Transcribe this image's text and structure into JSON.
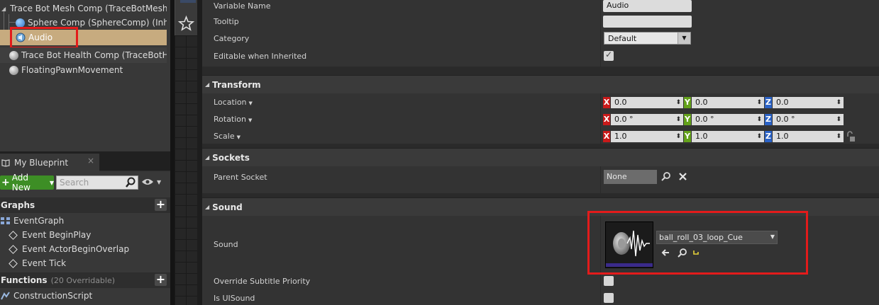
{
  "components": {
    "mesh_comp": "Trace Bot Mesh Comp (TraceBotMesh",
    "sphere_comp": "Sphere Comp (SphereComp) (Inherite",
    "audio": "Audio",
    "health_comp": "Trace Bot Health Comp (TraceBotHeal",
    "pawn_movement": "FloatingPawnMovement"
  },
  "my_blueprint": {
    "tab_label": "My Blueprint",
    "close_glyph": "×",
    "add_new_label": "Add New",
    "search_placeholder": "Search",
    "graphs_header": "Graphs",
    "event_graph": "EventGraph",
    "events": [
      "Event BeginPlay",
      "Event ActorBeginOverlap",
      "Event Tick"
    ],
    "functions_header": "Functions",
    "functions_overridable": "(20 Overridable)",
    "construction_script": "ConstructionScript"
  },
  "details": {
    "variable_name_label": "Variable Name",
    "variable_name_value": "Audio",
    "tooltip_label": "Tooltip",
    "tooltip_value": "",
    "category_label": "Category",
    "category_value": "Default",
    "editable_label": "Editable when Inherited",
    "editable_checked": true,
    "transform": {
      "header": "Transform",
      "location_label": "Location",
      "rotation_label": "Rotation",
      "scale_label": "Scale",
      "location": [
        "0.0",
        "0.0",
        "0.0"
      ],
      "rotation": [
        "0.0 °",
        "0.0 °",
        "0.0 °"
      ],
      "scale": [
        "1.0",
        "1.0",
        "1.0"
      ],
      "axes": [
        "X",
        "Y",
        "Z"
      ]
    },
    "sockets": {
      "header": "Sockets",
      "parent_socket_label": "Parent Socket",
      "parent_socket_value": "None"
    },
    "sound": {
      "header": "Sound",
      "sound_label": "Sound",
      "sound_value": "ball_roll_03_loop_Cue",
      "override_subtitle_label": "Override Subtitle Priority",
      "is_ui_sound_label": "Is UISound"
    }
  },
  "colors": {
    "selected_row": "#c7ab7f",
    "highlight_box": "#e31b1b",
    "add_new_green": "#3d8e25",
    "axis_x": "#c91a1a",
    "axis_y": "#64a21b",
    "axis_z": "#2a62c6"
  }
}
